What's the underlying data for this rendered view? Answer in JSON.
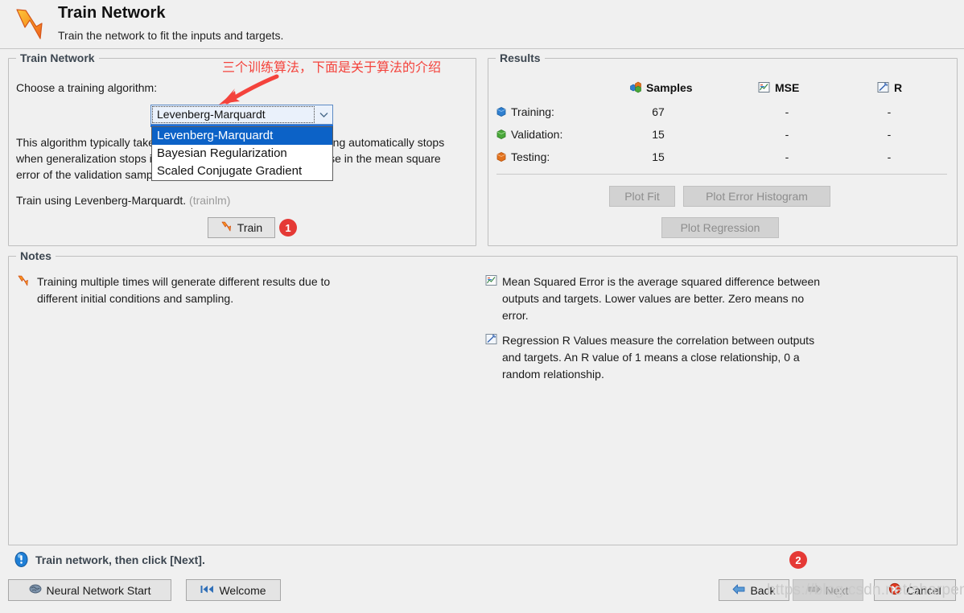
{
  "header": {
    "title": "Train Network",
    "subtitle": "Train the network to fit the inputs and targets.",
    "icon": "matlab-nn-arrow-icon"
  },
  "train_panel": {
    "legend": "Train Network",
    "choose_label": "Choose a training algorithm:",
    "combobox": {
      "name": "training-algorithm-select",
      "value": "Levenberg-Marquardt",
      "expanded": true,
      "options": [
        "Levenberg-Marquardt",
        "Bayesian Regularization",
        "Scaled Conjugate Gradient"
      ],
      "selected_index": 0,
      "arrow_icon": "chevron-down-icon"
    },
    "description": "This algorithm typically takes more memory but less time. Training automatically stops when generalization stops improving, as indicated by an increase in the mean square error of the validation samples.",
    "train_using_label": "Train using Levenberg-Marquardt.",
    "train_using_fn": "(trainlm)",
    "train_button": "Train"
  },
  "results_panel": {
    "legend": "Results",
    "columns": [
      {
        "label": "Samples",
        "icon": "samples-cubes-icon"
      },
      {
        "label": "MSE",
        "icon": "mse-chart-icon"
      },
      {
        "label": "R",
        "icon": "regression-pencil-icon"
      }
    ],
    "rows": [
      {
        "label": "Training:",
        "icon": "blue-cube-icon",
        "color": "#2f7fd0",
        "samples": "67",
        "mse": "-",
        "r": "-"
      },
      {
        "label": "Validation:",
        "icon": "green-cube-icon",
        "color": "#4aa83a",
        "samples": "15",
        "mse": "-",
        "r": "-"
      },
      {
        "label": "Testing:",
        "icon": "orange-cube-icon",
        "color": "#e3721d",
        "samples": "15",
        "mse": "-",
        "r": "-"
      }
    ],
    "buttons": {
      "plot_fit": "Plot Fit",
      "plot_error_histogram": "Plot Error Histogram",
      "plot_regression": "Plot Regression"
    }
  },
  "notes_panel": {
    "legend": "Notes",
    "left_note": {
      "icon": "train-arrow-icon",
      "text": "Training multiple times will generate different results due to different initial conditions and sampling."
    },
    "right_notes": [
      {
        "icon": "mse-chart-icon",
        "text": "Mean Squared Error is the average squared difference between outputs and targets. Lower values are better. Zero means no error."
      },
      {
        "icon": "regression-pencil-icon",
        "text": "Regression R Values measure the correlation between outputs and targets. An R value of 1 means a close relationship, 0 a random relationship."
      }
    ]
  },
  "status_bar": {
    "icon": "info-exclamation-icon",
    "text": "Train network, then click [Next]."
  },
  "footer": {
    "neural_network_start": "Neural Network Start",
    "welcome": "Welcome",
    "back": "Back",
    "next": "Next",
    "cancel": "Cancel",
    "next_disabled": true,
    "icons": {
      "nnstart": "brain-icon",
      "welcome": "skip-back-icon",
      "back": "left-arrow-icon",
      "next": "right-arrow-icon",
      "cancel": "red-x-circle-icon"
    }
  },
  "annotations": {
    "chinese_note": "三个训练算法，下面是关于算法的介绍",
    "arrow_icon": "red-arrow-icon",
    "badge_1": "1",
    "badge_2": "2",
    "color": "#f4433c"
  },
  "watermark": "https://blog.csdn.net/sharpen"
}
